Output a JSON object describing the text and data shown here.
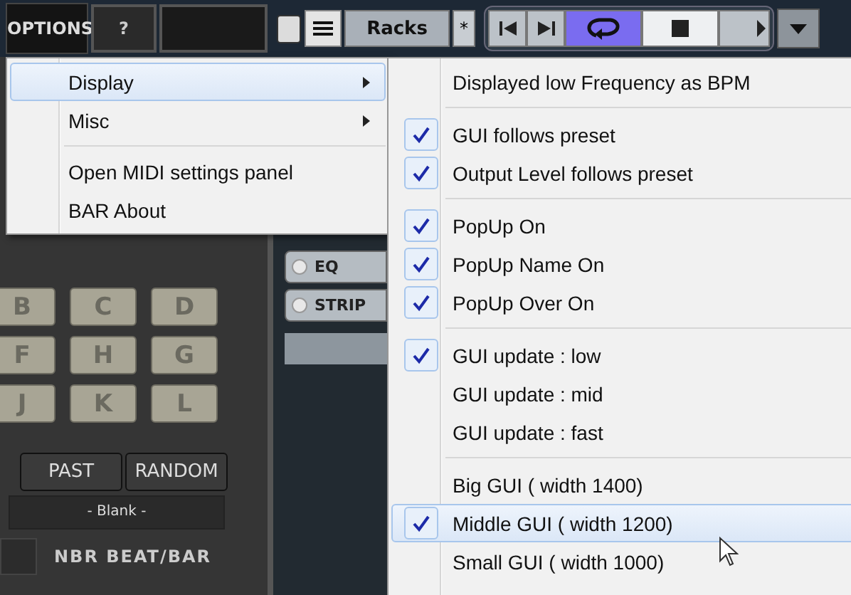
{
  "toolbar": {
    "options": "OPTIONS",
    "help": "?",
    "racks": "Racks",
    "star": "*",
    "transport": [
      {
        "kind": "prev",
        "selected": false
      },
      {
        "kind": "next",
        "selected": false
      },
      {
        "kind": "loop",
        "selected": true
      },
      {
        "kind": "stop",
        "selected": false
      },
      {
        "kind": "play",
        "selected": false
      }
    ]
  },
  "pads": [
    [
      "B",
      "C",
      "D"
    ],
    [
      "F",
      "H",
      "G"
    ],
    [
      "J",
      "K",
      "L"
    ]
  ],
  "pattern_buttons": [
    "PAST",
    "RANDOM"
  ],
  "preset": "- Blank -",
  "beat_label": "NBR BEAT/BAR",
  "strip_buttons": [
    {
      "label": "EQ",
      "on": false
    },
    {
      "label": "STRIP",
      "on": false
    }
  ],
  "menu": [
    {
      "kind": "item",
      "label": "Display",
      "submenu": true,
      "selected": true
    },
    {
      "kind": "item",
      "label": "Misc",
      "submenu": true,
      "selected": false
    },
    {
      "kind": "separator"
    },
    {
      "kind": "item",
      "label": "Open MIDI settings panel",
      "submenu": false,
      "selected": false
    },
    {
      "kind": "item",
      "label": "BAR About",
      "submenu": false,
      "selected": false
    }
  ],
  "submenu": [
    {
      "kind": "item",
      "label": "Displayed low Frequency as BPM",
      "checked": false,
      "selected": false
    },
    {
      "kind": "separator"
    },
    {
      "kind": "item",
      "label": "GUI follows preset",
      "checked": true,
      "selected": false
    },
    {
      "kind": "item",
      "label": "Output Level follows preset",
      "checked": true,
      "selected": false
    },
    {
      "kind": "separator"
    },
    {
      "kind": "item",
      "label": "PopUp On",
      "checked": true,
      "selected": false
    },
    {
      "kind": "item",
      "label": "PopUp Name On",
      "checked": true,
      "selected": false
    },
    {
      "kind": "item",
      "label": "PopUp Over On",
      "checked": true,
      "selected": false
    },
    {
      "kind": "separator"
    },
    {
      "kind": "item",
      "label": "GUI update : low",
      "checked": true,
      "selected": false
    },
    {
      "kind": "item",
      "label": "GUI update : mid",
      "checked": false,
      "selected": false
    },
    {
      "kind": "item",
      "label": "GUI update : fast",
      "checked": false,
      "selected": false
    },
    {
      "kind": "separator"
    },
    {
      "kind": "item",
      "label": "Big GUI ( width 1400)",
      "checked": false,
      "selected": false
    },
    {
      "kind": "item",
      "label": "Middle GUI ( width 1200)",
      "checked": true,
      "selected": true
    },
    {
      "kind": "item",
      "label": "Small GUI ( width 1000)",
      "checked": false,
      "selected": false
    }
  ]
}
